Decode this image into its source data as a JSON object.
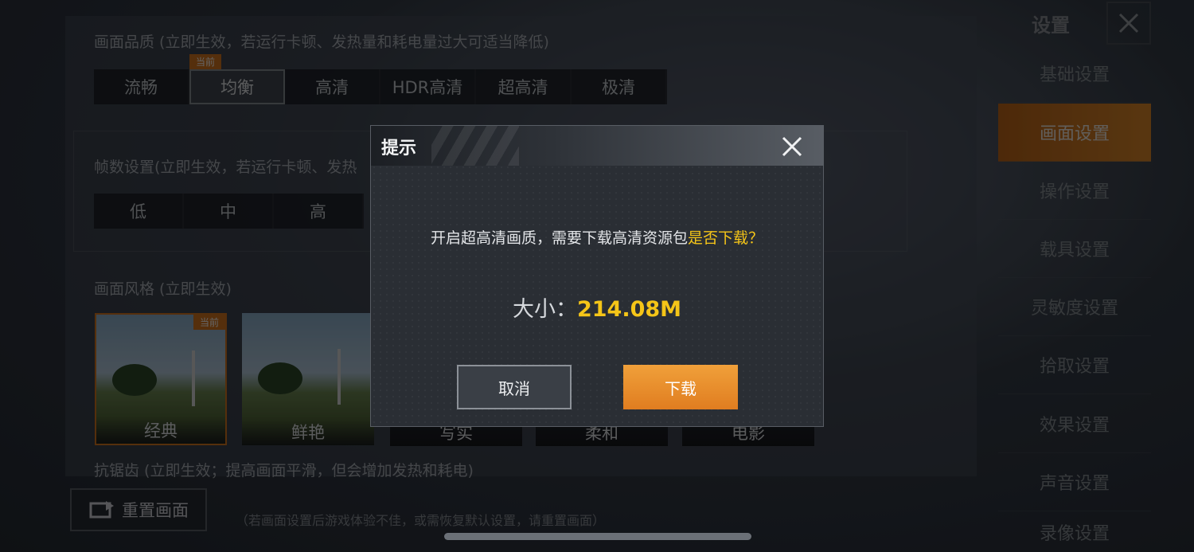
{
  "background": {
    "quality": {
      "title": "画面品质 (立即生效，若运行卡顿、发热量和耗电量过大可适当降低)",
      "current_tag": "当前",
      "options": [
        "流畅",
        "均衡",
        "高清",
        "HDR高清",
        "超高清",
        "极清"
      ],
      "selected": "均衡"
    },
    "fps": {
      "title": "帧数设置(立即生效，若运行卡顿、发热",
      "options": [
        "低",
        "中",
        "高"
      ]
    },
    "style": {
      "title": "画面风格 (立即生效)",
      "current_tag": "当前",
      "options": [
        "经典",
        "鲜艳",
        "写实",
        "柔和",
        "电影"
      ],
      "selected": "经典"
    },
    "antialias": {
      "title": "抗锯齿 (立即生效；提高画面平滑，但会增加发热和耗电)"
    },
    "reset_button": "重置画面",
    "reset_hint": "（若画面设置后游戏体验不佳，或需恢复默认设置，请重置画面）"
  },
  "sidebar": {
    "title": "设置",
    "items": [
      "基础设置",
      "画面设置",
      "操作设置",
      "载具设置",
      "灵敏度设置",
      "拾取设置",
      "效果设置",
      "声音设置",
      "录像设置"
    ],
    "active": "画面设置"
  },
  "dialog": {
    "title": "提示",
    "message_main": "开启超高清画质，需要下载高清资源包",
    "message_highlight": "是否下载？",
    "size_label": "大小：",
    "size_value": "214.08M",
    "cancel_label": "取消",
    "confirm_label": "下载"
  },
  "colors": {
    "accent": "#e08a2a",
    "highlight": "#f5c518",
    "selected_border": "#d9781f"
  }
}
